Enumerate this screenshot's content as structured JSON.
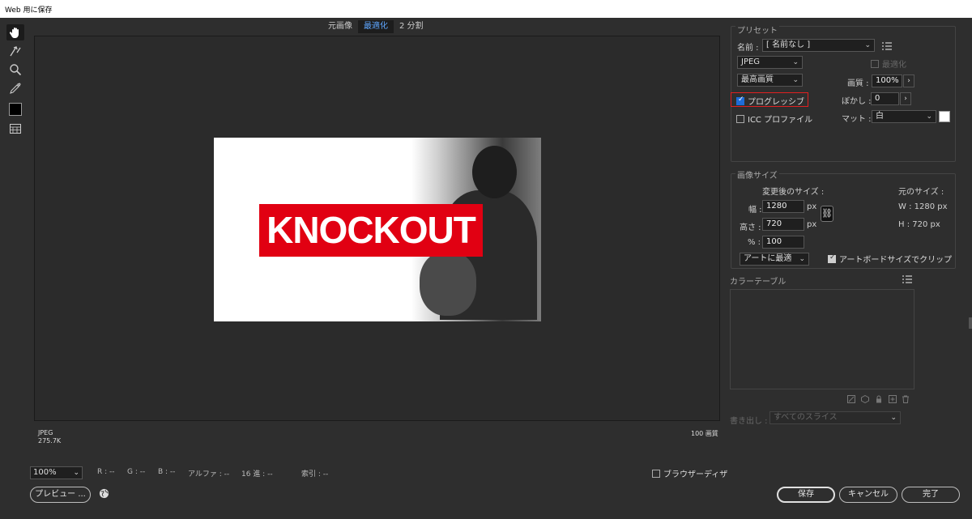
{
  "window": {
    "title": "Web 用に保存"
  },
  "tools": [
    "hand-tool-icon",
    "slice-select-tool-icon",
    "zoom-tool-icon",
    "eyedropper-tool-icon",
    "eyedropper-color-swatch",
    "toggle-slice-visibility-icon"
  ],
  "view_tabs": {
    "original": "元画像",
    "optimized": "最適化",
    "two_up": "2 分割"
  },
  "preview": {
    "banner_text": "KNOCKOUT",
    "format": "JPEG",
    "size": "275.7K",
    "zoom_info": "100 画質"
  },
  "status": {
    "zoom": "100%",
    "r": "R : --",
    "g": "G : --",
    "b": "B : --",
    "alpha": "アルファ : --",
    "hex": "16 進 : --",
    "index": "索引 : --",
    "browser_dither": "ブラウザーディザ"
  },
  "buttons": {
    "preview": "プレビュー ...",
    "save": "保存",
    "cancel": "キャンセル",
    "done": "完了"
  },
  "preset": {
    "group_title": "プリセット",
    "name_label": "名前 :",
    "name_value": "[ 名前なし ]",
    "format_value": "JPEG",
    "optimized_label": "最適化",
    "quality_preset": "最高画質",
    "quality_label": "画質 :",
    "quality_value": "100%",
    "progressive_label": "プログレッシブ",
    "blur_label": "ぼかし :",
    "blur_value": "0",
    "icc_label": "ICC プロファイル",
    "matte_label": "マット :",
    "matte_value": "白"
  },
  "image_size": {
    "group_title": "画像サイズ",
    "new_size_label": "変更後のサイズ :",
    "original_size_label": "元のサイズ :",
    "width_label": "幅 :",
    "width_value": "1280",
    "height_label": "高さ :",
    "height_value": "720",
    "unit": "px",
    "percent_label": "% :",
    "percent_value": "100",
    "orig_w": "W :  1280 px",
    "orig_h": "H :  720 px",
    "resample": "アートに最適",
    "clip_artboard": "アートボードサイズでクリップ"
  },
  "color_table": {
    "group_title": "カラーテーブル"
  },
  "export": {
    "label": "書き出し :",
    "value": "すべてのスライス"
  }
}
